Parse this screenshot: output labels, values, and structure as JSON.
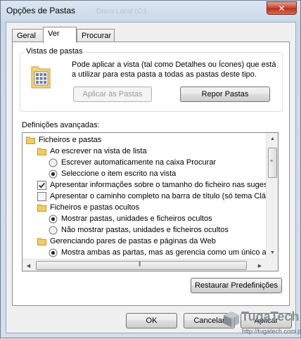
{
  "window": {
    "title": "Opções de Pastas",
    "background_title": "Disco Local (C:)",
    "close_glyph": "✕"
  },
  "tabs": [
    {
      "label": "Geral",
      "active": false
    },
    {
      "label": "Ver",
      "active": true
    },
    {
      "label": "Procurar",
      "active": false
    }
  ],
  "folder_views": {
    "title": "Vistas de pastas",
    "icon": "folder-grid-icon",
    "description": "Pode aplicar a vista (tal como Detalhes ou Ícones) que está a utilizar para esta pasta a todas as pastas deste tipo.",
    "apply_button": "Aplicar às Pastas",
    "apply_enabled": false,
    "reset_button": "Repor Pastas"
  },
  "advanced": {
    "label": "Definições avançadas:",
    "items": [
      {
        "type": "folder",
        "level": 0,
        "text": "Ficheiros e pastas"
      },
      {
        "type": "folder",
        "level": 1,
        "text": "Ao escrever na vista de lista"
      },
      {
        "type": "radio",
        "level": 2,
        "checked": false,
        "text": "Escrever automaticamente na caixa Procurar"
      },
      {
        "type": "radio",
        "level": 2,
        "checked": true,
        "text": "Seleccione o item escrito na vista"
      },
      {
        "type": "checkbox",
        "level": 1,
        "checked": true,
        "text": "Apresentar informações sobre o tamanho do ficheiro nas sugestões"
      },
      {
        "type": "checkbox",
        "level": 1,
        "checked": false,
        "text": "Apresentar o caminho completo na barra de título (só tema Clássico)"
      },
      {
        "type": "folder",
        "level": 1,
        "text": "Ficheiros e pastas ocultos"
      },
      {
        "type": "radio",
        "level": 2,
        "checked": true,
        "text": "Mostrar pastas, unidades e ficheiros ocultos"
      },
      {
        "type": "radio",
        "level": 2,
        "checked": false,
        "text": "Não mostrar pastas, unidades e ficheiros ocultos"
      },
      {
        "type": "folder",
        "level": 1,
        "text": "Gerenciando pares de pastas e páginas da Web"
      },
      {
        "type": "radio",
        "level": 2,
        "checked": true,
        "text": "Mostra ambas as partas, mas as gerencia como um único arquivo"
      }
    ],
    "restore_button": "Restaurar Predefinições"
  },
  "footer": {
    "ok": "OK",
    "cancel": "Cancelar",
    "apply": "Aplicar"
  },
  "watermark": {
    "name": "TugaTech",
    "url": "http://tugatech.com.pt"
  }
}
